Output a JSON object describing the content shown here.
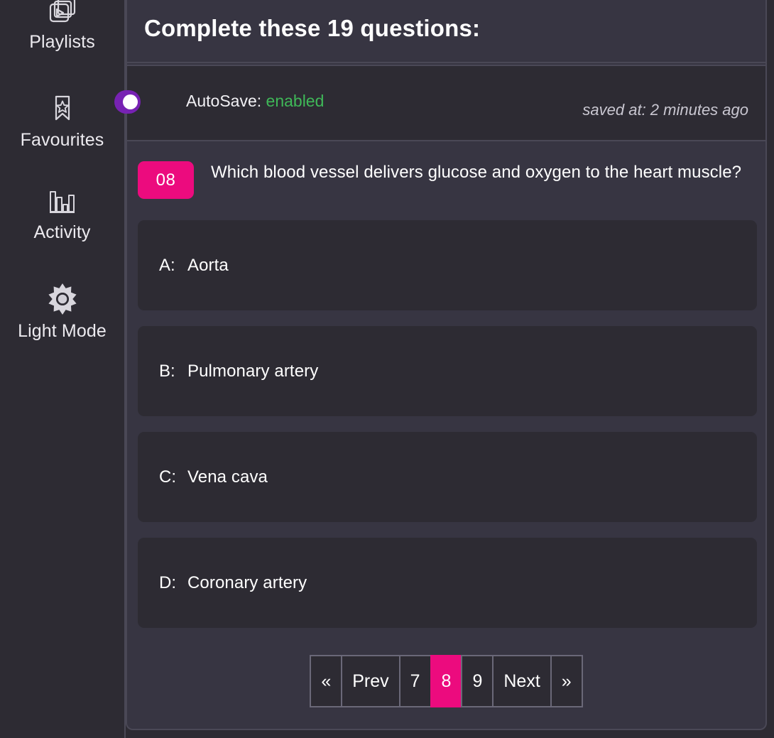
{
  "sidebar": {
    "items": [
      {
        "id": "playlists",
        "label": "Playlists",
        "icon": "playlist-stack-icon"
      },
      {
        "id": "favourites",
        "label": "Favourites",
        "icon": "bookmark-star-icon"
      },
      {
        "id": "activity",
        "label": "Activity",
        "icon": "bar-chart-icon"
      },
      {
        "id": "lightmode",
        "label": "Light Mode",
        "icon": "sun-icon"
      }
    ]
  },
  "header": {
    "title": "Complete these 19 questions:"
  },
  "autosave": {
    "label_prefix": "AutoSave:",
    "state": "enabled",
    "state_color": "#3fb858",
    "toggle_on": true,
    "toggle_color": "#7722b3",
    "saved_at": "saved at: 2 minutes ago"
  },
  "question": {
    "number": "08",
    "badge_color": "#ec0b7e",
    "text": "Which blood vessel delivers glucose and oxygen to the heart muscle?",
    "options": [
      {
        "key": "A:",
        "text": "Aorta"
      },
      {
        "key": "B:",
        "text": "Pulmonary artery"
      },
      {
        "key": "C:",
        "text": "Vena cava"
      },
      {
        "key": "D:",
        "text": "Coronary artery"
      }
    ]
  },
  "pagination": {
    "active_color": "#ec0b7e",
    "buttons": [
      {
        "label": "«",
        "name": "first",
        "active": false
      },
      {
        "label": "Prev",
        "name": "prev",
        "active": false
      },
      {
        "label": "7",
        "name": "page-7",
        "active": false
      },
      {
        "label": "8",
        "name": "page-8",
        "active": true
      },
      {
        "label": "9",
        "name": "page-9",
        "active": false
      },
      {
        "label": "Next",
        "name": "next",
        "active": false
      },
      {
        "label": "»",
        "name": "last",
        "active": false
      }
    ]
  }
}
